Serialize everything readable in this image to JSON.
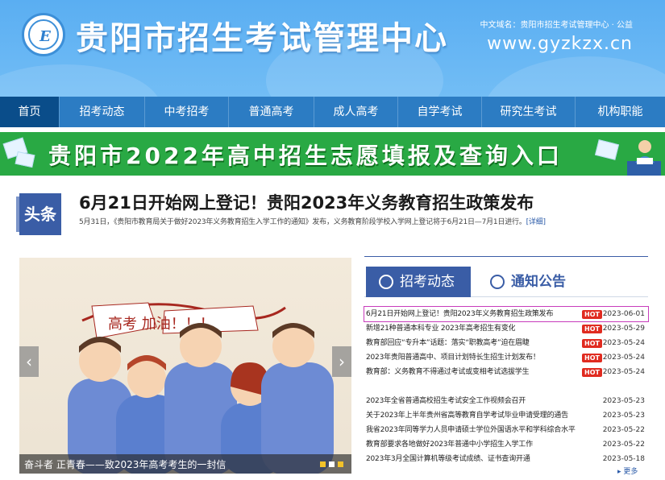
{
  "header": {
    "title": "贵阳市招生考试管理中心",
    "domain_cn": "中文域名：贵阳市招生考试管理中心 · 公益",
    "domain_en": "www.gyzkzx.cn"
  },
  "nav": {
    "items": [
      {
        "label": "首页",
        "active": true
      },
      {
        "label": "招考动态"
      },
      {
        "label": "中考招考"
      },
      {
        "label": "普通高考"
      },
      {
        "label": "成人高考"
      },
      {
        "label": "自学考试"
      },
      {
        "label": "研究生考试"
      },
      {
        "label": "机构职能"
      }
    ]
  },
  "banner": {
    "text": "贵阳市2022年高中招生志愿填报及查询入口"
  },
  "headline": {
    "tag": "头条",
    "title": "6月21日开始网上登记！贵阳2023年义务教育招生政策发布",
    "summary": "5月31日，《贵阳市教育局关于做好2023年义务教育招生入学工作的通知》发布，义务教育阶段学校入学网上登记将于6月21日—7月1日进行。",
    "more": "[详细]"
  },
  "slider": {
    "caption": "奋斗者 正青春——致2023年高考考生的一封信",
    "banner_text": "高考 加油！！！"
  },
  "tabs": {
    "active": "招考动态",
    "inactive": "通知公告"
  },
  "news_hot": [
    {
      "title": "6月21日开始网上登记！贵阳2023年义务教育招生政策发布",
      "hot": "HOT",
      "date": "2023-06-01"
    },
    {
      "title": "新增21种普通本科专业 2023年高考招生有变化",
      "hot": "HOT",
      "date": "2023-05-29"
    },
    {
      "title": "教育部回应“专升本”话题：落实“职教高考”迫在眉睫",
      "hot": "HOT",
      "date": "2023-05-24"
    },
    {
      "title": "2023年贵阳普通高中、项目计划特长生招生计划发布！",
      "hot": "HOT",
      "date": "2023-05-24"
    },
    {
      "title": "教育部：义务教育不得通过考试或变相考试选拔学生",
      "hot": "HOT",
      "date": "2023-05-24"
    }
  ],
  "news_list": [
    {
      "title": "2023年全省普通高校招生考试安全工作视频会召开",
      "date": "2023-05-23"
    },
    {
      "title": "关于2023年上半年贵州省高等教育自学考试毕业申请受理的通告",
      "date": "2023-05-23"
    },
    {
      "title": "我省2023年同等学力人员申请硕士学位外国语水平和学科综合水平",
      "date": "2023-05-22"
    },
    {
      "title": "教育部要求各地做好2023年普通中小学招生入学工作",
      "date": "2023-05-22"
    },
    {
      "title": "2023年3月全国计算机等级考试成绩、证书查询开通",
      "date": "2023-05-18"
    }
  ],
  "more_label": "更多",
  "colors": {
    "header": "#5aaef2",
    "nav": "#2c7cc3",
    "nav_active": "#0a4d8a",
    "banner": "#29a944",
    "accent": "#3a5da6",
    "hot": "#e02b20"
  }
}
